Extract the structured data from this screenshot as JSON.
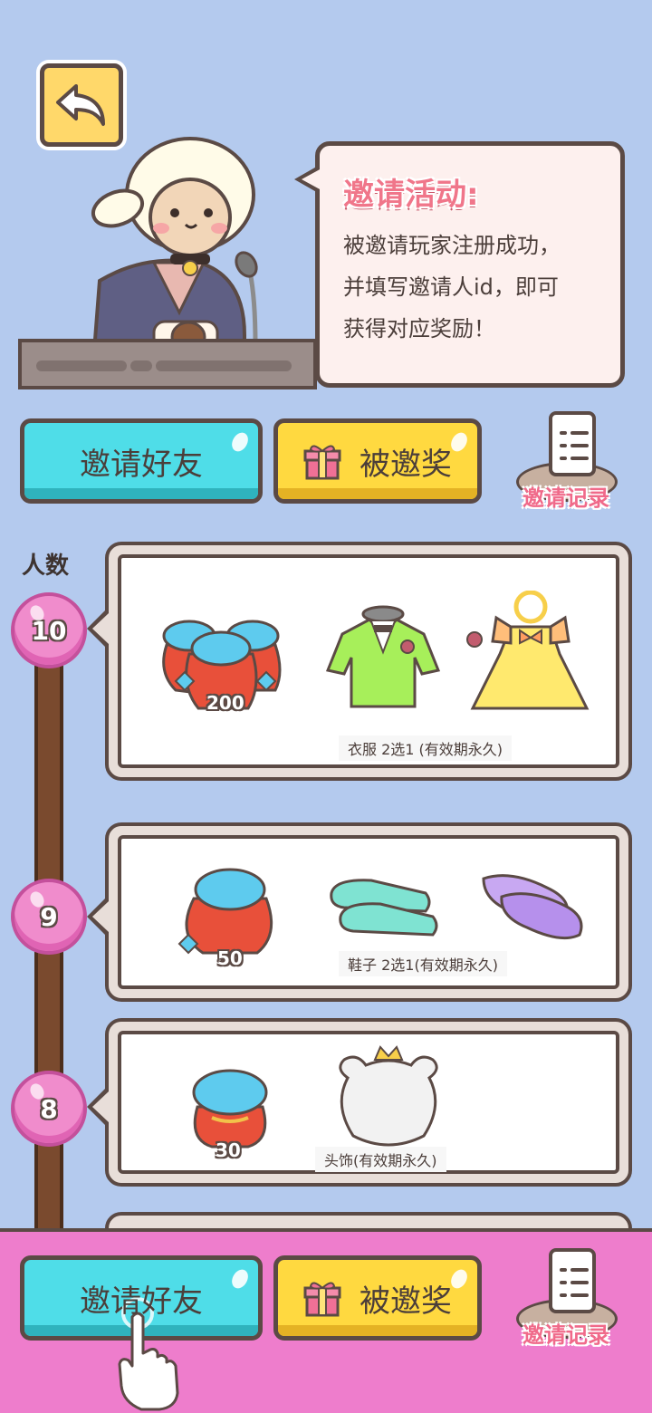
{
  "header": {
    "back_icon": "back-arrow-icon"
  },
  "bubble": {
    "title": "邀请活动:",
    "lines": [
      "被邀请玩家注册成功，",
      "并填写邀请人id，即可",
      "获得对应奖励！"
    ]
  },
  "actions": {
    "invite_label": "邀请好友",
    "invited_label": "被邀奖",
    "record_label": "邀请记录"
  },
  "tiers": {
    "axis_label": "人数",
    "t10": {
      "count": "10",
      "diamonds": "200",
      "caption": "衣服 2选1 (有效期永久)"
    },
    "t9": {
      "count": "9",
      "diamonds": "50",
      "caption": "鞋子 2选1(有效期永久)"
    },
    "t8": {
      "count": "8",
      "diamonds": "30",
      "caption": "头饰(有效期永久)"
    }
  },
  "footer": {
    "invite_label": "邀请好友",
    "invited_label": "被邀奖",
    "record_label": "邀请记录"
  },
  "colors": {
    "background": "#b4caee",
    "invite_button": "#4fdde8",
    "invited_button": "#ffd940",
    "footer": "#ee7dcc",
    "node": "#f08ccc"
  }
}
